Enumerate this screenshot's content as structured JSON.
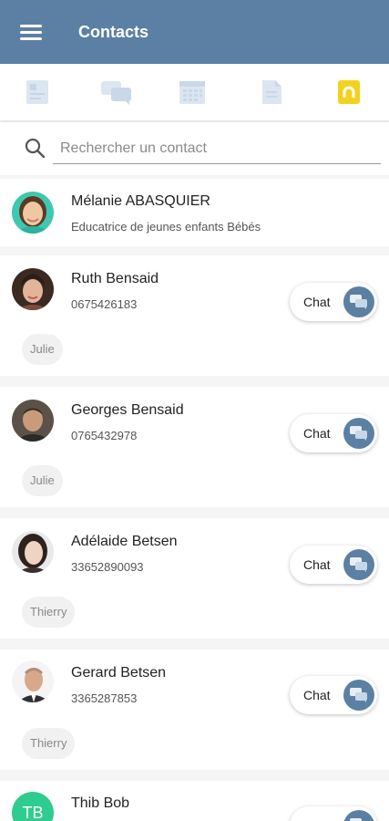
{
  "header": {
    "title": "Contacts"
  },
  "toolbar": {
    "icons": [
      "journal-icon",
      "chat-icon",
      "calendar-icon",
      "document-icon",
      "contacts-icon"
    ],
    "active_color": "#f2d21d",
    "inactive_color": "#dbe6f1",
    "accent_color": "#5b80a3"
  },
  "search": {
    "placeholder": "Rechercher un contact",
    "value": ""
  },
  "contacts": [
    {
      "name": "Mélanie ABASQUIER",
      "subtitle": "Educatrice de jeunes enfants Bébés"
    },
    {
      "name": "Ruth Bensaid",
      "phone": "0675426183",
      "chat_label": "Chat",
      "tag": "Julie"
    },
    {
      "name": "Georges Bensaid",
      "phone": "0765432978",
      "chat_label": "Chat",
      "tag": "Julie"
    },
    {
      "name": "Adélaide Betsen",
      "phone": "33652890093",
      "chat_label": "Chat",
      "tag": "Thierry"
    },
    {
      "name": "Gerard Betsen",
      "phone": "3365287853",
      "chat_label": "Chat",
      "tag": "Thierry"
    },
    {
      "name": "Thib Bob",
      "initials": "TB"
    }
  ]
}
